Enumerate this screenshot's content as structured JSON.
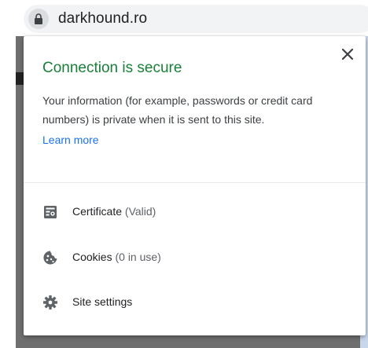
{
  "address_bar": {
    "domain": "darkhound.ro",
    "lock_icon": "lock-icon"
  },
  "popup": {
    "title": "Connection is secure",
    "description": "Your information (for example, passwords or credit card numbers) is private when it is sent to this site.",
    "learn_more": "Learn more",
    "close_icon": "close-icon",
    "title_color": "#188038",
    "link_color": "#1a73e8",
    "items": [
      {
        "label": "Certificate",
        "sub": " (Valid)",
        "icon": "certificate-icon"
      },
      {
        "label": "Cookies",
        "sub": " (0 in use)",
        "icon": "cookie-icon"
      },
      {
        "label": "Site settings",
        "sub": "",
        "icon": "gear-icon"
      }
    ]
  }
}
